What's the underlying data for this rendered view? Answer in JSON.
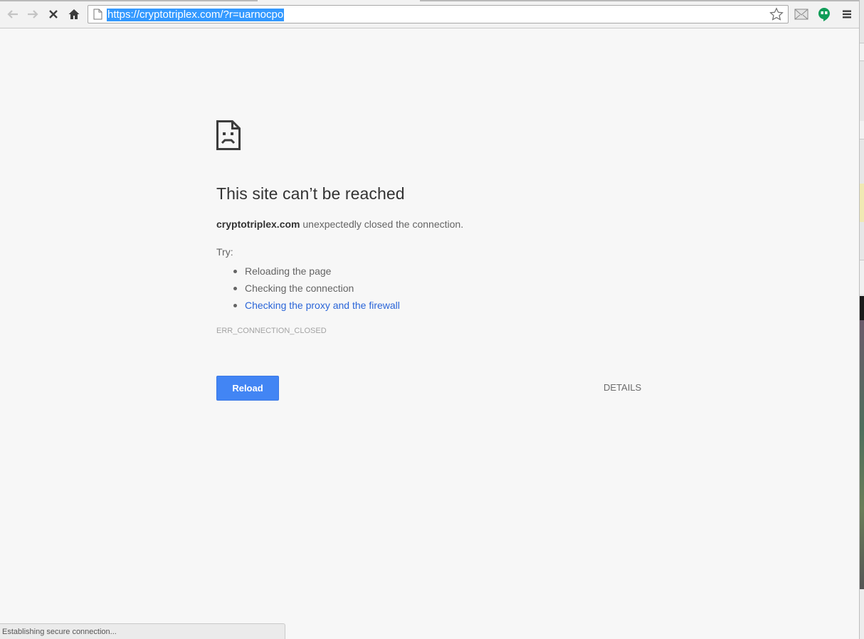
{
  "browser": {
    "url": "https://cryptotriplex.com/?r=uarnocpo",
    "status_text": "Establishing secure connection..."
  },
  "error_page": {
    "heading": "This site can’t be reached",
    "host": "cryptotriplex.com",
    "summary_rest": " unexpectedly closed the connection.",
    "try_label": "Try:",
    "suggestions": [
      "Reloading the page",
      "Checking the connection",
      "Checking the proxy and the firewall"
    ],
    "error_code": "ERR_CONNECTION_CLOSED",
    "reload_label": "Reload",
    "details_label": "DETAILS"
  },
  "colors": {
    "accent": "#4285f4",
    "link": "#2a65d8",
    "url_selection": "#3399ff",
    "hangouts_green": "#0f9d58"
  },
  "icons": [
    "back-icon",
    "forward-icon",
    "stop-icon",
    "home-icon",
    "page-icon",
    "star-icon",
    "mail-icon",
    "hangouts-icon",
    "menu-icon",
    "sad-page-icon"
  ]
}
